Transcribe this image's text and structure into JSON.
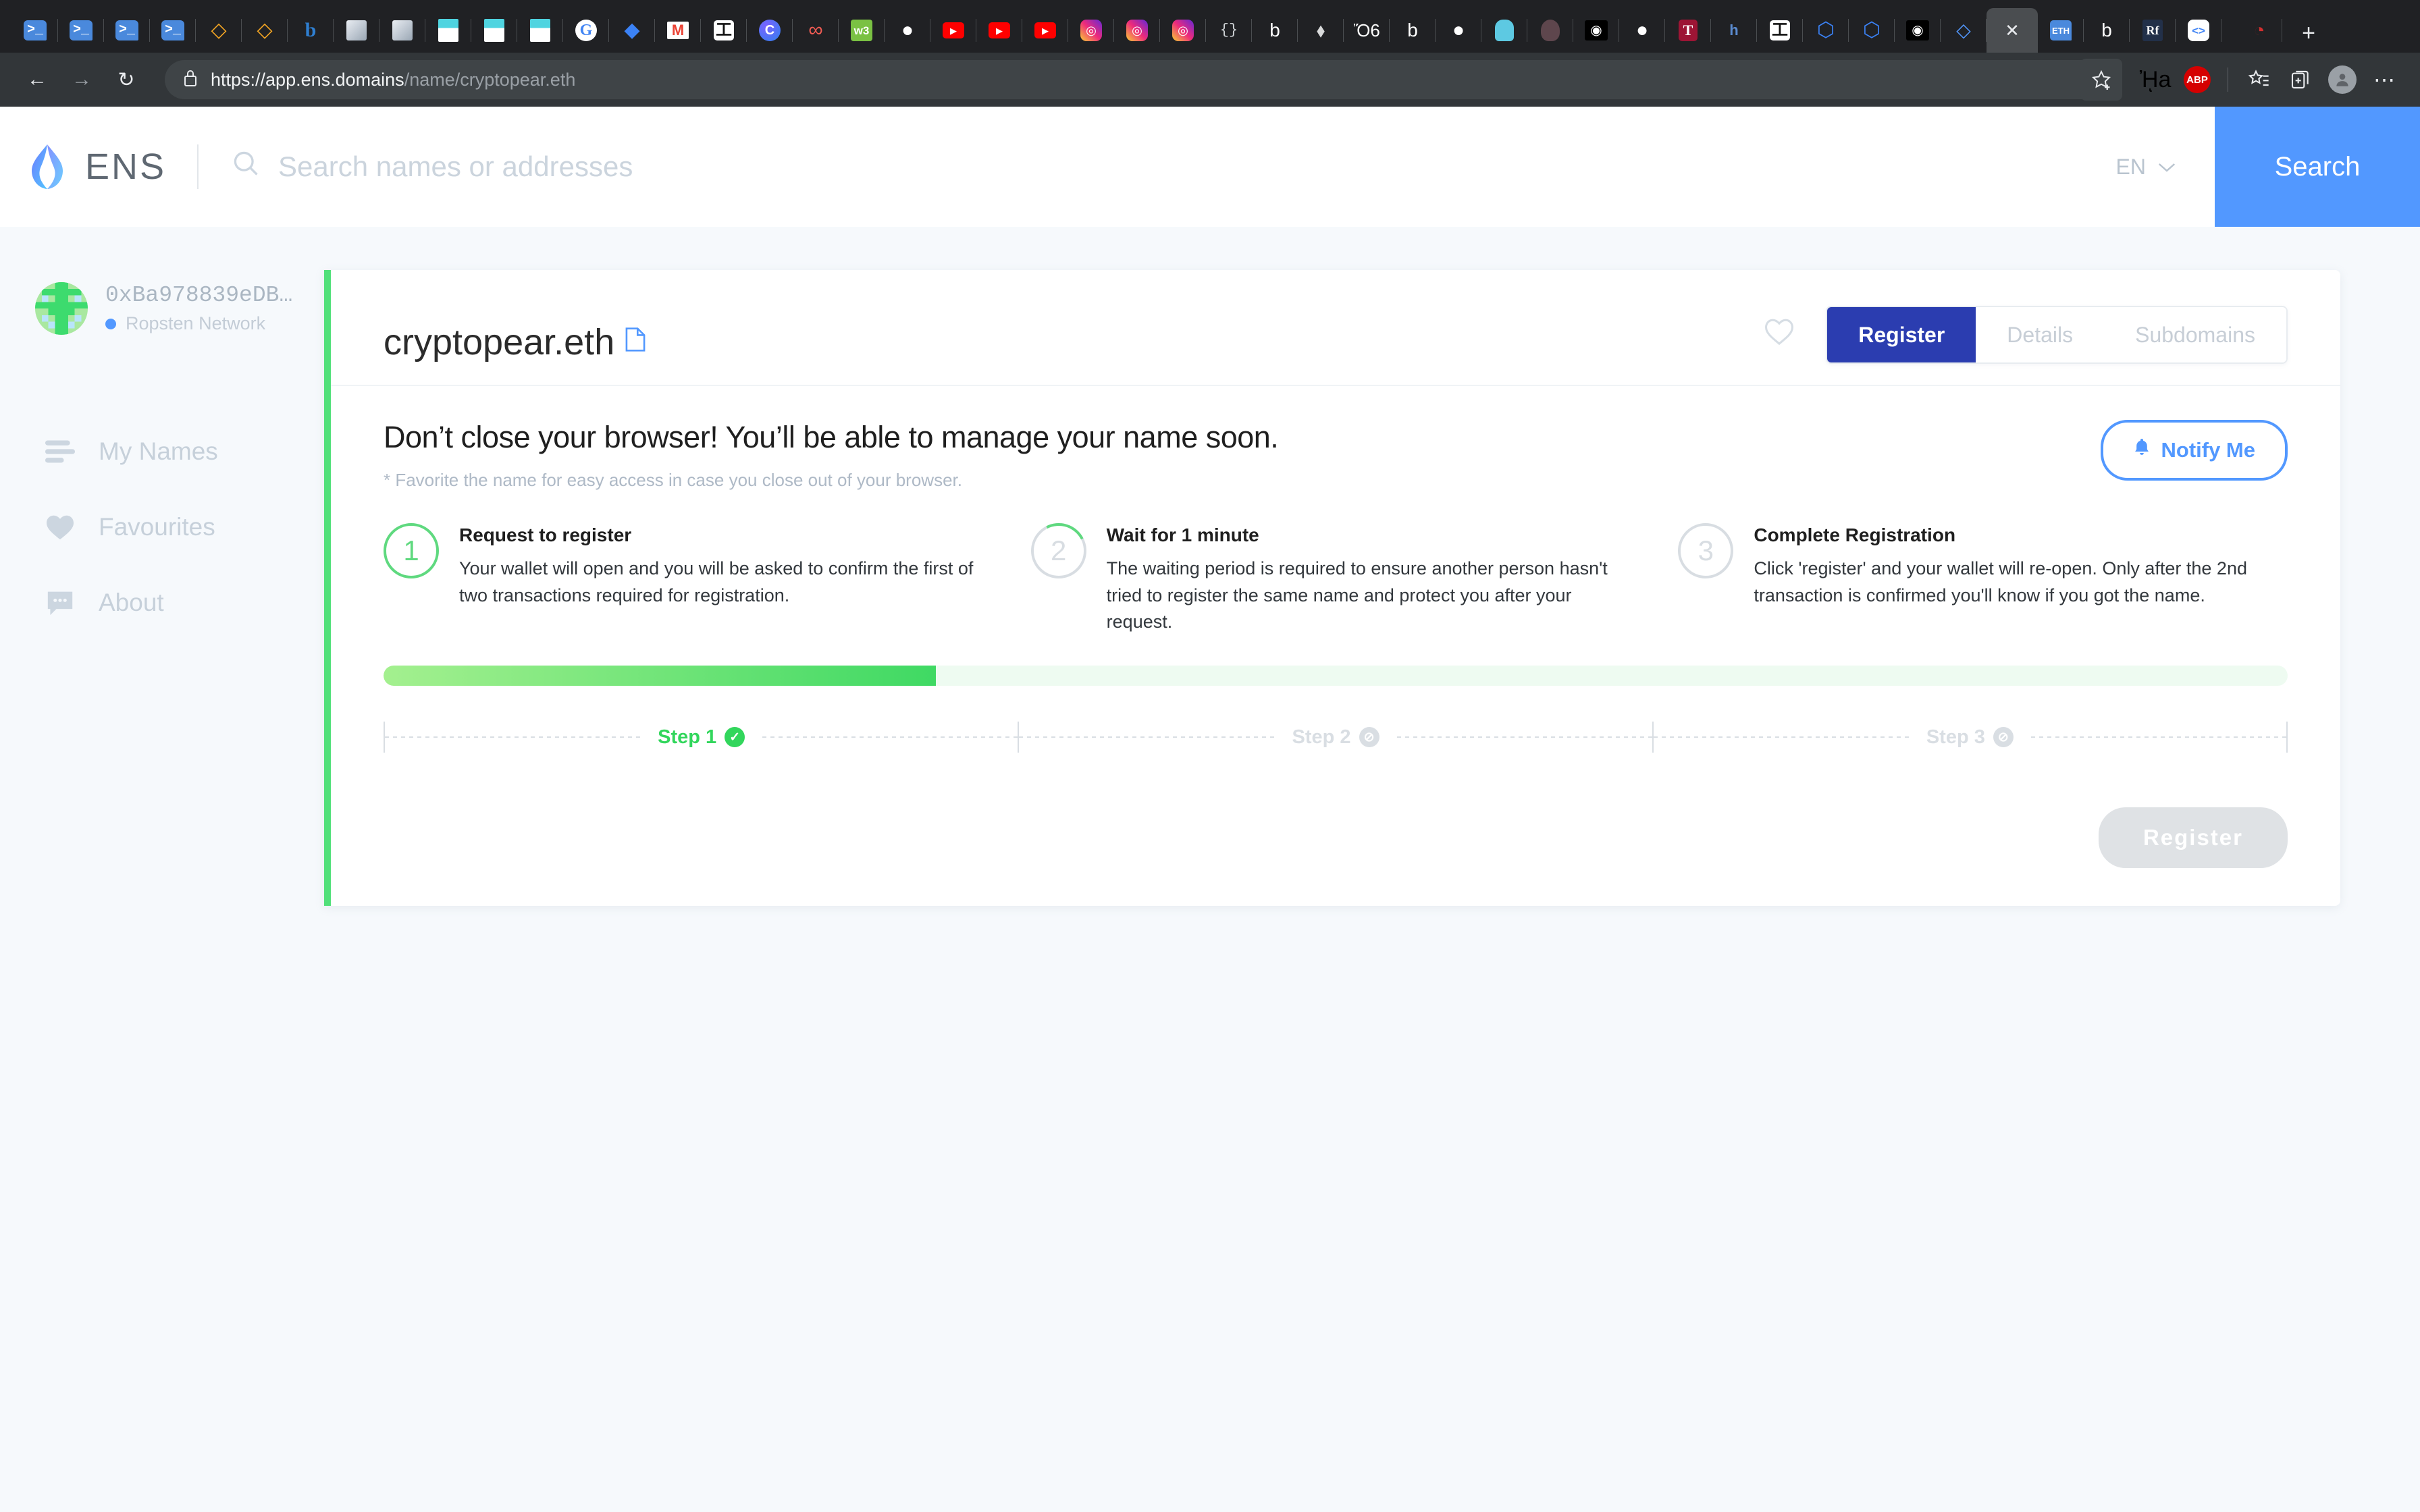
{
  "browser": {
    "tabs": [
      {
        "name": "terminal-tab",
        "glyph": ">_",
        "cls": "ic-term"
      },
      {
        "name": "terminal-tab",
        "glyph": ">_",
        "cls": "ic-term"
      },
      {
        "name": "terminal-tab",
        "glyph": ">_",
        "cls": "ic-term"
      },
      {
        "name": "terminal-tab",
        "glyph": ">_",
        "cls": "ic-term"
      },
      {
        "name": "ethereum-tab",
        "glyph": "◇",
        "cls": "ic-eth-orange"
      },
      {
        "name": "ethereum-tab",
        "glyph": "◇",
        "cls": "ic-eth-orange"
      },
      {
        "name": "bootstrap-tab",
        "glyph": "b",
        "cls": "ic-bold-b"
      },
      {
        "name": "chart-tab",
        "glyph": "",
        "cls": "ic-chart"
      },
      {
        "name": "chart-tab",
        "glyph": "",
        "cls": "ic-chart"
      },
      {
        "name": "notes-tab",
        "glyph": "",
        "cls": "ic-paper-teal"
      },
      {
        "name": "notes-tab",
        "glyph": "",
        "cls": "ic-paper-teal"
      },
      {
        "name": "notes-tab",
        "glyph": "",
        "cls": "ic-paper-teal"
      },
      {
        "name": "google-tab",
        "glyph": "G",
        "cls": "ic-google"
      },
      {
        "name": "diamond-tab",
        "glyph": "◆",
        "cls": "ic-blue-dia"
      },
      {
        "name": "gmail-tab",
        "glyph": "M",
        "cls": "ic-gmail"
      },
      {
        "name": "torus-tab",
        "glyph": "工",
        "cls": "ic-black-t"
      },
      {
        "name": "coinbase-tab",
        "glyph": "C",
        "cls": "ic-c-circle"
      },
      {
        "name": "infinity-tab",
        "glyph": "∞",
        "cls": "ic-infinity"
      },
      {
        "name": "w3schools-tab",
        "glyph": "w3",
        "cls": "ic-w3"
      },
      {
        "name": "github-tab",
        "glyph": "●",
        "cls": "ic-github"
      },
      {
        "name": "youtube-tab",
        "glyph": "▶",
        "cls": "ic-yt"
      },
      {
        "name": "youtube-tab",
        "glyph": "▶",
        "cls": "ic-yt"
      },
      {
        "name": "youtube-tab",
        "glyph": "▶",
        "cls": "ic-yt"
      },
      {
        "name": "instagram-tab",
        "glyph": "◎",
        "cls": "ic-insta"
      },
      {
        "name": "instagram-tab",
        "glyph": "◎",
        "cls": "ic-insta"
      },
      {
        "name": "instagram-tab",
        "glyph": "◎",
        "cls": "ic-insta"
      },
      {
        "name": "json-tab",
        "glyph": "{}",
        "cls": "ic-braces"
      },
      {
        "name": "document-tab",
        "glyph": "὜b",
        "cls": "ic-doc"
      },
      {
        "name": "ethereum-tab",
        "glyph": "⬧",
        "cls": "ic-eth-grey"
      },
      {
        "name": "docs-tab",
        "glyph": "Ὅ6",
        "cls": "ic-book"
      },
      {
        "name": "document-tab",
        "glyph": "὜b",
        "cls": "ic-doc"
      },
      {
        "name": "github-tab",
        "glyph": "●",
        "cls": "ic-github"
      },
      {
        "name": "golang-tab",
        "glyph": "",
        "cls": "ic-gopher"
      },
      {
        "name": "truffle-tab",
        "glyph": "",
        "cls": "ic-truffle"
      },
      {
        "name": "medium-tab",
        "glyph": "◉",
        "cls": "ic-medium"
      },
      {
        "name": "github-tab",
        "glyph": "●",
        "cls": "ic-github"
      },
      {
        "name": "temple-tab",
        "glyph": "T",
        "cls": "ic-temple"
      },
      {
        "name": "hackernoon-tab",
        "glyph": "h",
        "cls": "ic-h"
      },
      {
        "name": "torus-tab",
        "glyph": "工",
        "cls": "ic-black-t"
      },
      {
        "name": "ens-tab",
        "glyph": "⬡",
        "cls": "ic-blue-dia"
      },
      {
        "name": "ens-tab",
        "glyph": "⬡",
        "cls": "ic-blue-dia"
      },
      {
        "name": "medium-tab",
        "glyph": "◉",
        "cls": "ic-medium"
      },
      {
        "name": "ens-tab",
        "glyph": "◇",
        "cls": "ic-ens-small"
      }
    ],
    "active_tab": {
      "name": "active-tab",
      "glyph": "✕",
      "cls": "ic-x"
    },
    "tabs_after": [
      {
        "name": "ethereum-tab",
        "glyph": "ETH",
        "cls": "ic-ethtag"
      },
      {
        "name": "document-tab",
        "glyph": "὜b",
        "cls": "ic-doc"
      },
      {
        "name": "rf-tab",
        "glyph": "Rf",
        "cls": "ic-rf"
      },
      {
        "name": "codepen-tab",
        "glyph": "<>",
        "cls": "ic-codepen"
      }
    ],
    "tabs_far": [
      {
        "name": "ruby-tab",
        "glyph": "◔",
        "cls": "ic-ruby"
      }
    ],
    "new_tab_label": "+",
    "back_icon": "←",
    "forward_icon": "→",
    "reload_icon": "↻",
    "lock_icon": "ὑ2",
    "url_prefix": "https://app.ens.domains",
    "url_suffix": "/name/cryptopear.eth",
    "star_icon": "☆",
    "metamask_icon": "ᾘa",
    "adblock_label": "ABP",
    "collections_icon": "★",
    "split_icon": "❐",
    "profile_icon": "὆4",
    "more_icon": "⋯"
  },
  "ens_header": {
    "brand": "ENS",
    "search_placeholder": "Search names or addresses",
    "search_value": "",
    "search_icon": "⌕",
    "language": "EN",
    "chevron": "⌄",
    "search_button": "Search"
  },
  "sidebar": {
    "address": "0xBa978839eDB…",
    "network": "Ropsten Network",
    "items": [
      {
        "label": "My Names",
        "icon": "list-icon",
        "name": "sidebar-item-my-names"
      },
      {
        "label": "Favourites",
        "icon": "heart-icon",
        "name": "sidebar-item-favourites"
      },
      {
        "label": "About",
        "icon": "chat-icon",
        "name": "sidebar-item-about"
      }
    ]
  },
  "card": {
    "domain": "cryptopear.eth",
    "copy_icon": "὜b",
    "heart_icon": "♡",
    "tabs": [
      {
        "label": "Register",
        "selected": true
      },
      {
        "label": "Details",
        "selected": false
      },
      {
        "label": "Subdomains",
        "selected": false
      }
    ],
    "headline": "Don’t close your browser! You’ll be able to manage your name soon.",
    "sub_note": "* Favorite the name for easy access in case you close out of your browser.",
    "notify_button": "Notify Me",
    "notify_icon": "ὑ4",
    "steps": [
      {
        "number": "1",
        "title": "Request to register",
        "desc": "Your wallet will open and you will be asked to confirm the first of two transactions required for registration.",
        "state": "done"
      },
      {
        "number": "2",
        "title": "Wait for 1 minute",
        "desc": "The waiting period is required to ensure another person hasn't tried to register the same name and protect you after your request.",
        "state": "partial"
      },
      {
        "number": "3",
        "title": "Complete Registration",
        "desc": "Click 'register' and your wallet will re-open. Only after the 2nd transaction is confirmed you'll know if you got the name.",
        "state": "pending"
      }
    ],
    "progress_percent": 29,
    "step_labels": [
      {
        "label": "Step 1",
        "mark": "✓",
        "active": true
      },
      {
        "label": "Step 2",
        "mark": "⊘",
        "active": false
      },
      {
        "label": "Step 3",
        "mark": "⊘",
        "active": false
      }
    ],
    "register_button": "Register"
  }
}
